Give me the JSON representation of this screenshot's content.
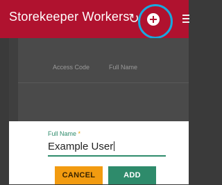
{
  "header": {
    "title": "Storekeeper Workers",
    "refresh_icon": "refresh-icon",
    "add_icon": "add-circle-icon",
    "more_icon": "more-icon",
    "accent_color": "#b0122f",
    "highlight_color": "#18a9df"
  },
  "table": {
    "columns": [
      "Access Code",
      "Full Name"
    ]
  },
  "dialog": {
    "field_label": "Full Name",
    "required_mark": "*",
    "field_value": "Example User",
    "cancel_label": "CANCEL",
    "add_label": "ADD",
    "cancel_color": "#f29b10",
    "add_color": "#2e8b6b"
  }
}
